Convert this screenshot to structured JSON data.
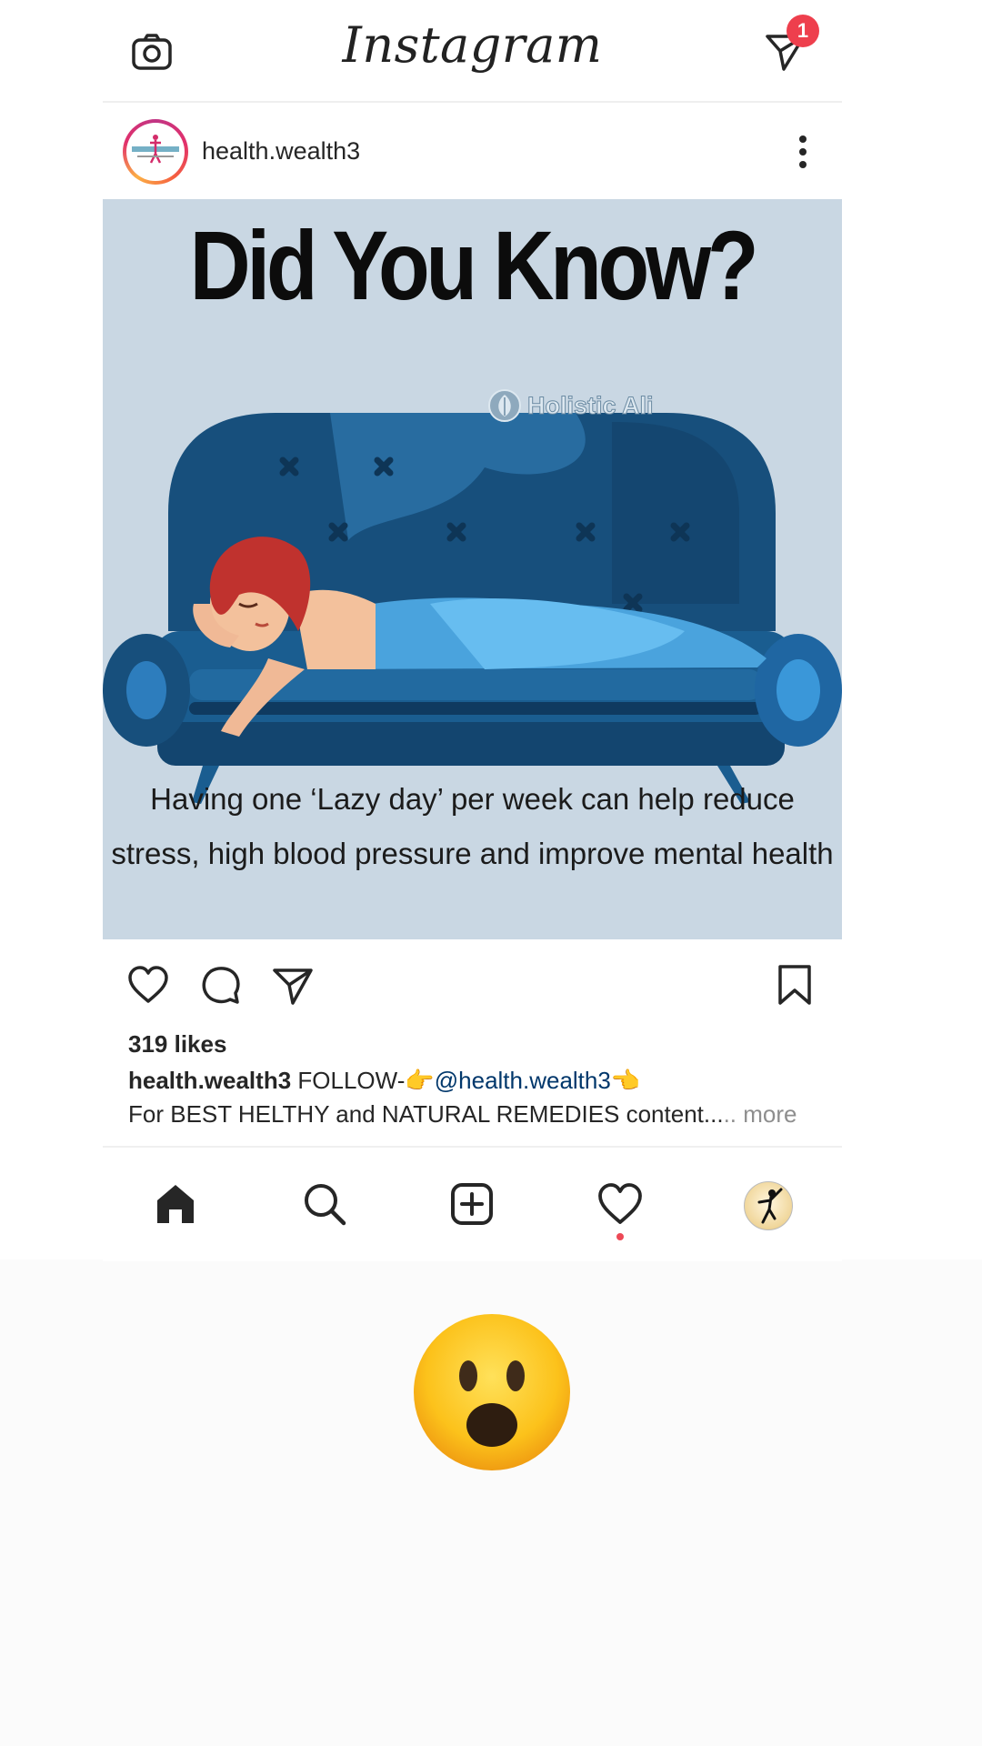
{
  "app": {
    "title": "Instagram",
    "notification_count": "1"
  },
  "post": {
    "username": "health.wealth3",
    "image": {
      "headline": "Did You Know?",
      "watermark": "Holistic Ali",
      "caption_text": "Having one ‘Lazy day’ per week can help reduce stress, high blood pressure and improve mental health"
    },
    "likes": "319 likes",
    "caption": {
      "username": "health.wealth3",
      "text_before": "FOLLOW-👉",
      "mention": "@health.wealth3",
      "text_after": "👈",
      "line2": "For BEST HELTHY and NATURAL REMEDIES content...",
      "more": ".. more"
    }
  },
  "reaction": {
    "emoji": "astonished-face"
  },
  "colors": {
    "badge": "#ee3f4d",
    "post_background": "#c9d7e3",
    "mention": "#00376b",
    "activity_dot": "#ed4956"
  }
}
